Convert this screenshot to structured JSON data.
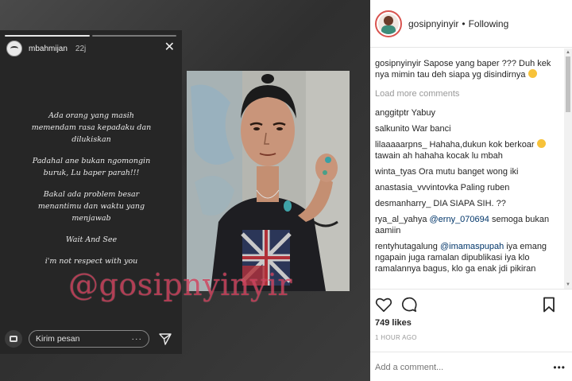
{
  "story": {
    "username": "mbahmijan",
    "time": "22j",
    "lines": [
      "Ada orang yang masih\nmemendam rasa kepadaku dan\ndilukiskan",
      "Padahal ane bukan ngomongin\nburuk, Lu baper parah!!!",
      "Bakal ada problem besar\nmenantimu dan waktu yang\nmenjawab",
      "Wait And See",
      "i'm not respect with you"
    ],
    "message_placeholder": "Kirim pesan"
  },
  "watermark": "@gosipnyinyir",
  "post": {
    "username": "gosipnyinyir",
    "separator": "•",
    "follow_status": "Following",
    "caption_user": "gosipnyinyir",
    "caption_text": "Sapose yang baper ??? Duh kek nya mimin tau deh siapa yg disindirnya",
    "load_more": "Load more comments",
    "comments": [
      {
        "user": "anggitptr",
        "text": "Yabuy"
      },
      {
        "user": "salkunito",
        "text": "War banci"
      },
      {
        "user": "lilaaaaarpns_",
        "text": "Hahaha,dukun kok berkoar",
        "text2": "tawain ah hahaha kocak lu mbah"
      },
      {
        "user": "winta_tyas",
        "text": "Ora mutu banget wong iki"
      },
      {
        "user": "anastasia_vvvintovka",
        "text": "Paling ruben"
      },
      {
        "user": "desmanharry_",
        "text": "DIA SIAPA SIH. ??"
      },
      {
        "user": "rya_al_yahya",
        "mention": "@erny_070694",
        "text": "semoga bukan aamiin"
      },
      {
        "user": "rentyhutagalung",
        "mention": "@imamaspupah",
        "text": "iya emang ngapain juga ramalan dipublikasi iya klo ramalannya bagus, klo ga enak jdi pikiran"
      }
    ],
    "likes": "749 likes",
    "time": "1 HOUR AGO",
    "add_comment_placeholder": "Add a comment...",
    "more": "•••"
  }
}
